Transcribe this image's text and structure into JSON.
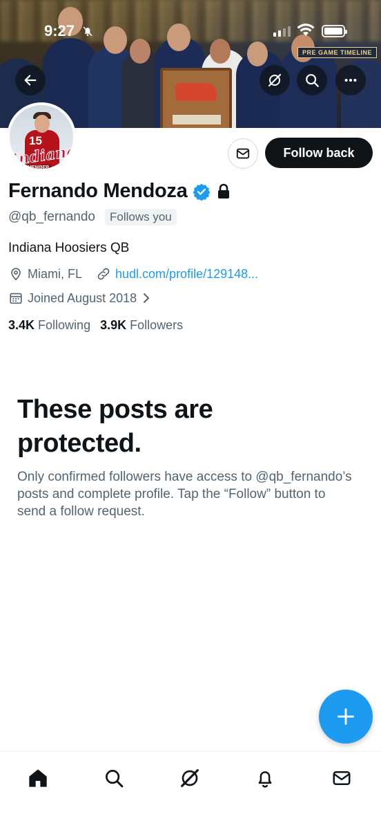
{
  "status_bar": {
    "time": "9:27"
  },
  "banner": {
    "sign_text": "PRE GAME TIMELINE"
  },
  "avatar": {
    "jersey_number": "15",
    "jersey_word": "INDIANA",
    "script_text": "Indiana",
    "tag_text": "HUB MEMBER"
  },
  "actions": {
    "follow_label": "Follow back"
  },
  "profile": {
    "name": "Fernando Mendoza",
    "handle": "@qb_fernando",
    "follows_you": "Follows you",
    "bio": "Indiana Hoosiers QB",
    "location": "Miami, FL",
    "website": "hudl.com/profile/129148...",
    "joined": "Joined August 2018",
    "following_count": "3.4K",
    "following_label": "Following",
    "followers_count": "3.9K",
    "followers_label": "Followers"
  },
  "protected": {
    "title": "These posts are protected.",
    "body": "Only confirmed followers have access to @qb_fernando’s posts and complete profile. Tap the “Follow” button to send a follow request."
  },
  "icons": {
    "back": "arrow-left-icon",
    "grok": "grok-icon",
    "search": "search-icon",
    "more": "more-icon",
    "message": "envelope-icon",
    "verified": "verified-badge-icon",
    "lock": "lock-icon",
    "location": "location-pin-icon",
    "link": "link-icon",
    "calendar": "calendar-icon",
    "compose": "plus-icon",
    "tabs": [
      "home-icon",
      "search-icon",
      "grok-icon",
      "bell-icon",
      "envelope-icon"
    ]
  },
  "colors": {
    "accent": "#1d9bf0",
    "text": "#0f1419",
    "secondary": "#536471",
    "button_dark": "#0f1419"
  }
}
